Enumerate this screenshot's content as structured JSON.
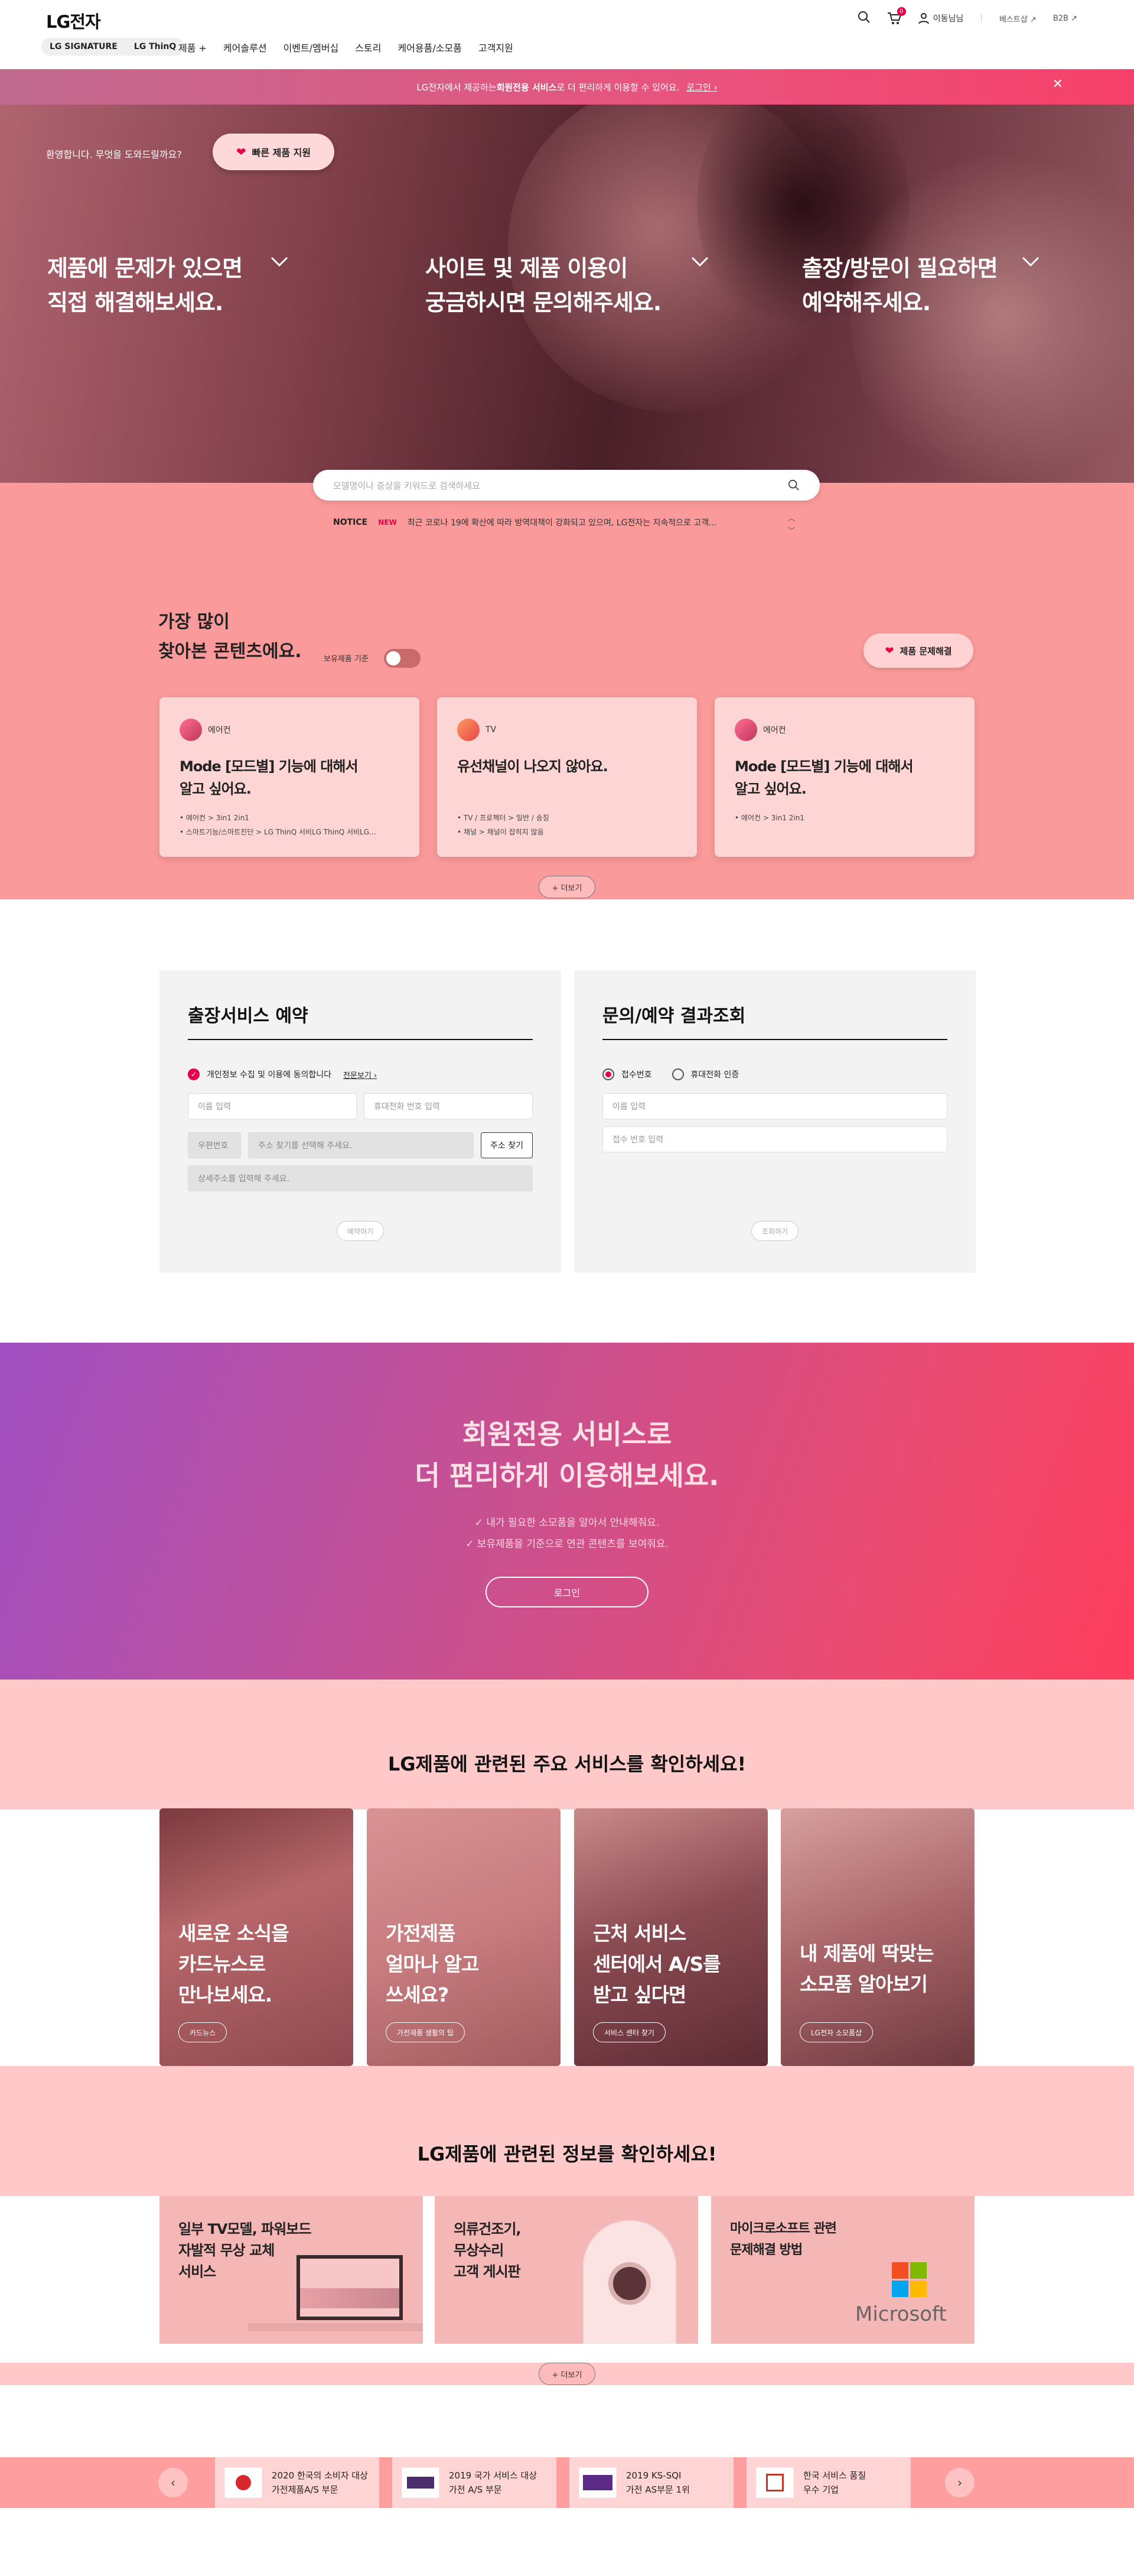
{
  "header": {
    "logo": "LG전자",
    "brand_tabs": [
      "LG SIGNATURE",
      "LG ThinQ"
    ],
    "nav": [
      "제품",
      "케어솔루션",
      "이벤트/멤버십",
      "스토리",
      "케어용품/소모품",
      "고객지원"
    ],
    "cart_count": "0",
    "user_name": "이동님님",
    "util_links": [
      "베스트샵",
      "B2B"
    ]
  },
  "notice_bar": {
    "text_before": "LG전자에서 제공하는 ",
    "text_bold": "회원전용 서비스",
    "text_after": "로 더 편리하게 이용할 수 있어요.",
    "link": "로그인"
  },
  "hero": {
    "greeting": "환영합니다. 무엇을 도와드릴까요?",
    "quick_button": "빠른 제품 지원",
    "columns": [
      {
        "line1": "제품에 문제가 있으면",
        "line2": "직접 해결해보세요."
      },
      {
        "line1": "사이트 및 제품 이용이",
        "line2": "궁금하시면 문의해주세요."
      },
      {
        "line1": "출장/방문이 필요하면",
        "line2": "예약해주세요."
      }
    ]
  },
  "search": {
    "placeholder": "모델명이나 증상을 키워드로 검색하세요"
  },
  "notice": {
    "label": "NOTICE",
    "badge": "NEW",
    "text": "최근 코로나 19에 확산에 따라 방역대책이 강화되고 있으며, LG전자는 지속적으로 고객..."
  },
  "popular": {
    "title_line1": "가장 많이",
    "title_line2": "찾아본 콘텐츠에요.",
    "owned_label": "보유제품 기준",
    "owned_toggle": false,
    "solve_button": "제품 문제해결",
    "cards": [
      {
        "category": "에어컨",
        "title1": "Mode [모드별] 기능에 대해서",
        "title2": "알고 싶어요.",
        "tags": [
          "에어컨 > 3in1 2in1",
          "스마트기능/스마트진단 > LG ThinQ 서비LG ThinQ 서비LG..."
        ]
      },
      {
        "category": "TV",
        "title1": "유선채널이 나오지 않아요.",
        "title2": "",
        "tags": [
          "TV / 프로젝터 > 일반 / 송칭",
          "채널 > 채널이 잡히지 않음"
        ]
      },
      {
        "category": "에어컨",
        "title1": "Mode [모드별] 기능에 대해서",
        "title2": "알고 싶어요.",
        "tags": [
          "에어컨 > 3in1 2in1"
        ]
      }
    ],
    "more": "+ 더보기"
  },
  "visit_form": {
    "title": "출장서비스 예약",
    "agree": "개인정보 수집 및 이용에 동의합니다",
    "agree_link": "전문보기",
    "name_placeholder": "이름 입력",
    "phone_placeholder": "휴대전화 번호 입력",
    "zip_placeholder": "우편번호",
    "addr_placeholder": "주소 찾기를 선택해 주세요.",
    "find_button": "주소 찾기",
    "detail_placeholder": "상세주소를 입력해 주세요.",
    "submit": "예약하기"
  },
  "inquiry_form": {
    "title": "문의/예약 결과조회",
    "radio1": "접수번호",
    "radio2": "휴대전화 인증",
    "name_placeholder": "이름 입력",
    "receipt_placeholder": "접수 번호 입력",
    "submit": "조회하기"
  },
  "member": {
    "line1": "회원전용 서비스로",
    "line2": "더 편리하게 이용해보세요.",
    "bullet1": "내가 필요한 소모품을 알아서 안내해줘요.",
    "bullet2": "보유제품을 기준으로 연관 콘텐츠를 보여줘요.",
    "login": "로그인"
  },
  "services": {
    "title": "LG제품에 관련된 주요 서비스를 확인하세요!",
    "items": [
      {
        "l1": "새로운 소식을",
        "l2": "카드뉴스로",
        "l3": "만나보세요.",
        "pill": "카드뉴스"
      },
      {
        "l1": "가전제품",
        "l2": "얼마나 알고",
        "l3": "쓰세요?",
        "pill": "가전제품 생활의 팁"
      },
      {
        "l1": "근처 서비스",
        "l2": "센터에서 A/S를",
        "l3": "받고 싶다면",
        "pill": "서비스 센터 찾기"
      },
      {
        "l1": "내 제품에 딱맞는",
        "l2": "소모품 알아보기",
        "l3": "",
        "pill": "LG전자 소모품샵"
      }
    ]
  },
  "info": {
    "title": "LG제품에 관련된 정보를 확인하세요!",
    "items": [
      {
        "l1": "일부 TV모델, 파워보드",
        "l2": "자발적 무상 교체",
        "l3": "서비스"
      },
      {
        "l1": "의류건조기,",
        "l2": "무상수리",
        "l3": "고객 게시판"
      },
      {
        "l1": "마이크로소프트 관련",
        "l2": "문제해결 방법",
        "l3": "",
        "brand": "Microsoft"
      }
    ],
    "more": "+ 더보기"
  },
  "awards": [
    {
      "l1": "2020 한국의 소비자 대상",
      "l2": "가전제품A/S 부문"
    },
    {
      "l1": "2019 국가 서비스 대상",
      "l2": "가전 A/S 부문"
    },
    {
      "l1": "2019 KS-SQI",
      "l2": "가전 AS부문 1위"
    },
    {
      "l1": "한국 서비스 품질",
      "l2": "우수 기업"
    }
  ]
}
